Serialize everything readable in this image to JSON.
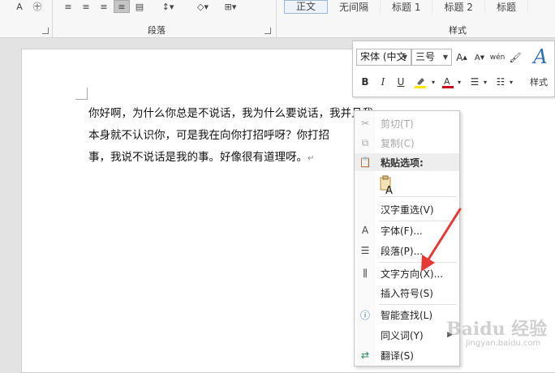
{
  "ribbon": {
    "groups": {
      "paragraph_label": "段落",
      "styles_label": "样式"
    },
    "styles": [
      "正文",
      "无间隔",
      "标题 1",
      "标题 2",
      "标题"
    ]
  },
  "document": {
    "lines": [
      "你好啊，为什么你总是不说话，我为什么要说话，我并且我",
      "本身就不认识你，可是我在向你打招呼呀？你打招",
      "事，我说不说话是我的事。好像很有道理呀。"
    ],
    "paragraph_mark": "↵"
  },
  "mini_toolbar": {
    "font_name": "宋体 (中文",
    "font_size": "三号",
    "bold": "B",
    "italic": "I",
    "underline": "U",
    "styles_label": "样式",
    "font_color_hex": "#d0021b",
    "highlight_hex": "#ffe600"
  },
  "context_menu": {
    "cut": "剪切(T)",
    "copy": "复制(C)",
    "paste_options": "粘贴选项:",
    "reconvert": "汉字重选(V)",
    "font": "字体(F)...",
    "paragraph": "段落(P)...",
    "text_direction": "文字方向(X)...",
    "insert_symbol": "插入符号(S)",
    "smart_lookup": "智能查找(L)",
    "synonyms": "同义词(Y)",
    "translate": "翻译(S)"
  },
  "watermark": {
    "text": "Baidu 经验",
    "sub": "jingyan.baidu.com"
  }
}
